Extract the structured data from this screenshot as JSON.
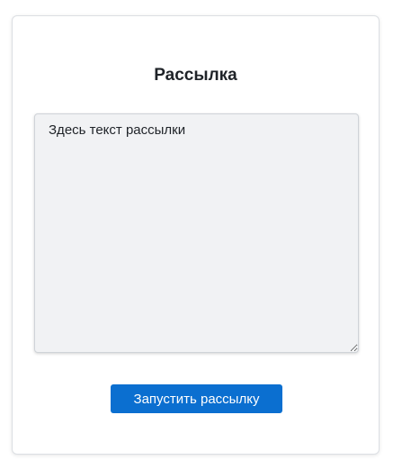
{
  "mailing": {
    "title": "Рассылка",
    "message_placeholder": "Здесь текст рассылки",
    "message_value": "",
    "send_button_label": "Запустить рассылку"
  },
  "colors": {
    "accent": "#0b6fd0",
    "textarea_bg": "#f1f2f4",
    "text": "#1f2328"
  }
}
